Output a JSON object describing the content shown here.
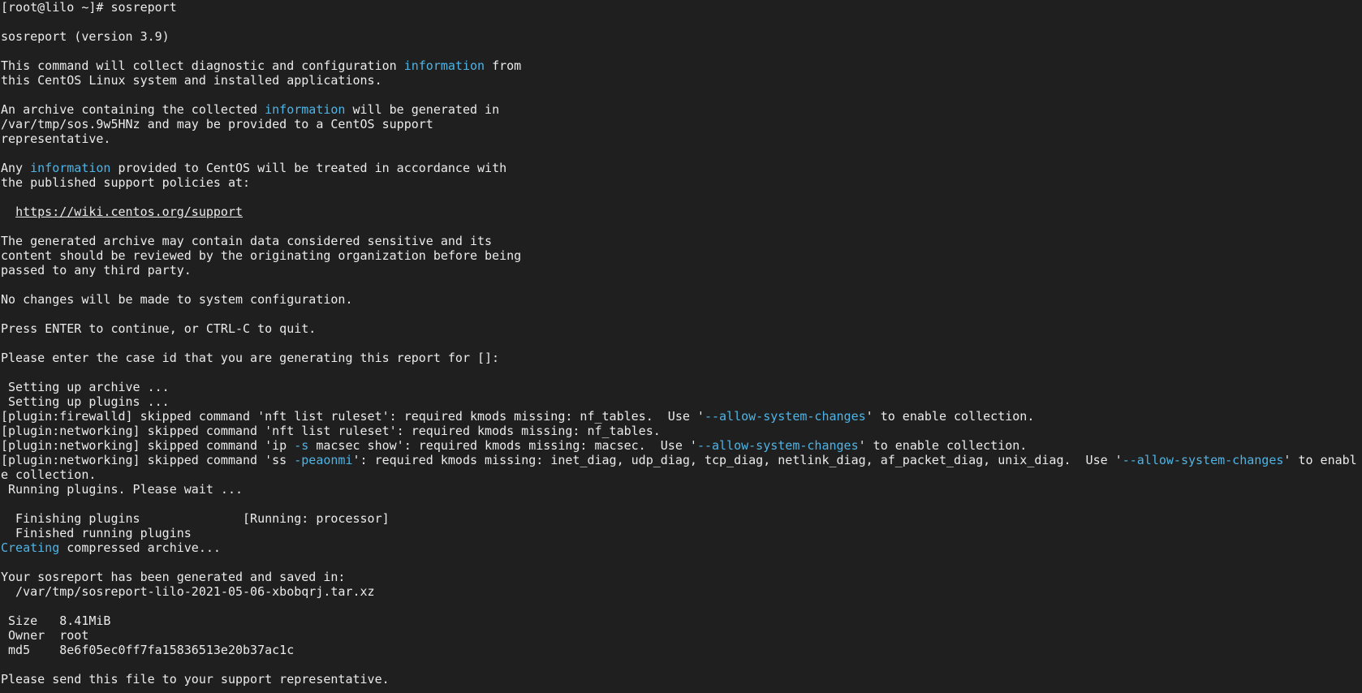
{
  "terminal": {
    "colors": {
      "background": "#1f1f1f",
      "foreground": "#ebebeb",
      "highlight": "#4fb4e5"
    },
    "lines": [
      [
        {
          "t": "[root@lilo ~]# sosreport"
        }
      ],
      [],
      [
        {
          "t": "sosreport (version 3.9)"
        }
      ],
      [],
      [
        {
          "t": "This command will collect diagnostic and configuration "
        },
        {
          "t": "information",
          "c": "hl"
        },
        {
          "t": " from"
        }
      ],
      [
        {
          "t": "this CentOS Linux system and installed applications."
        }
      ],
      [],
      [
        {
          "t": "An archive containing the collected "
        },
        {
          "t": "information",
          "c": "hl"
        },
        {
          "t": " will be generated in"
        }
      ],
      [
        {
          "t": "/var/tmp/sos.9w5HNz and may be provided to a CentOS support"
        }
      ],
      [
        {
          "t": "representative."
        }
      ],
      [],
      [
        {
          "t": "Any "
        },
        {
          "t": "information",
          "c": "hl"
        },
        {
          "t": " provided to CentOS will be treated in accordance with"
        }
      ],
      [
        {
          "t": "the published support policies at:"
        }
      ],
      [],
      [
        {
          "t": "  "
        },
        {
          "t": "https://wiki.centos.org/support",
          "c": "link",
          "name": "support-url-link",
          "interactable": true
        }
      ],
      [],
      [
        {
          "t": "The generated archive may contain data considered sensitive and its"
        }
      ],
      [
        {
          "t": "content should be reviewed by the originating organization before being"
        }
      ],
      [
        {
          "t": "passed to any third party."
        }
      ],
      [],
      [
        {
          "t": "No changes will be made to system configuration."
        }
      ],
      [],
      [
        {
          "t": "Press ENTER to continue, or CTRL-C to quit."
        }
      ],
      [],
      [
        {
          "t": "Please enter the case id that you are generating this report for []:"
        }
      ],
      [],
      [
        {
          "t": " Setting up archive ..."
        }
      ],
      [
        {
          "t": " Setting up plugins ..."
        }
      ],
      [
        {
          "t": "[plugin:firewalld] skipped command 'nft list ruleset': required kmods missing: nf_tables.  Use '"
        },
        {
          "t": "--allow-system-changes",
          "c": "hl"
        },
        {
          "t": "' to enable collection."
        }
      ],
      [
        {
          "t": "[plugin:networking] skipped command 'nft list ruleset': required kmods missing: nf_tables."
        }
      ],
      [
        {
          "t": "[plugin:networking] skipped command 'ip "
        },
        {
          "t": "-s",
          "c": "hl"
        },
        {
          "t": " macsec show': required kmods missing: macsec.  Use '"
        },
        {
          "t": "--allow-system-changes",
          "c": "hl"
        },
        {
          "t": "' to enable collection."
        }
      ],
      [
        {
          "t": "[plugin:networking] skipped command 'ss "
        },
        {
          "t": "-peaonmi",
          "c": "hl"
        },
        {
          "t": "': required kmods missing: inet_diag, udp_diag, tcp_diag, netlink_diag, af_packet_diag, unix_diag.  Use '"
        },
        {
          "t": "--allow-system-changes",
          "c": "hl"
        },
        {
          "t": "' to enabl"
        }
      ],
      [
        {
          "t": "e collection."
        }
      ],
      [
        {
          "t": " Running plugins. Please wait ..."
        }
      ],
      [],
      [
        {
          "t": "  Finishing plugins              [Running: processor]"
        }
      ],
      [
        {
          "t": "  Finished running plugins"
        }
      ],
      [
        {
          "t": "Creating",
          "c": "hl"
        },
        {
          "t": " compressed archive..."
        }
      ],
      [],
      [
        {
          "t": "Your sosreport has been generated and saved in:"
        }
      ],
      [
        {
          "t": "  /var/tmp/sosreport-lilo-2021-05-06-xbobqrj.tar.xz"
        }
      ],
      [],
      [
        {
          "t": " Size   8.41MiB"
        }
      ],
      [
        {
          "t": " Owner  root"
        }
      ],
      [
        {
          "t": " md5    8e6f05ec0ff7fa15836513e20b37ac1c"
        }
      ],
      [],
      [
        {
          "t": "Please send this file to your support representative."
        }
      ]
    ]
  }
}
